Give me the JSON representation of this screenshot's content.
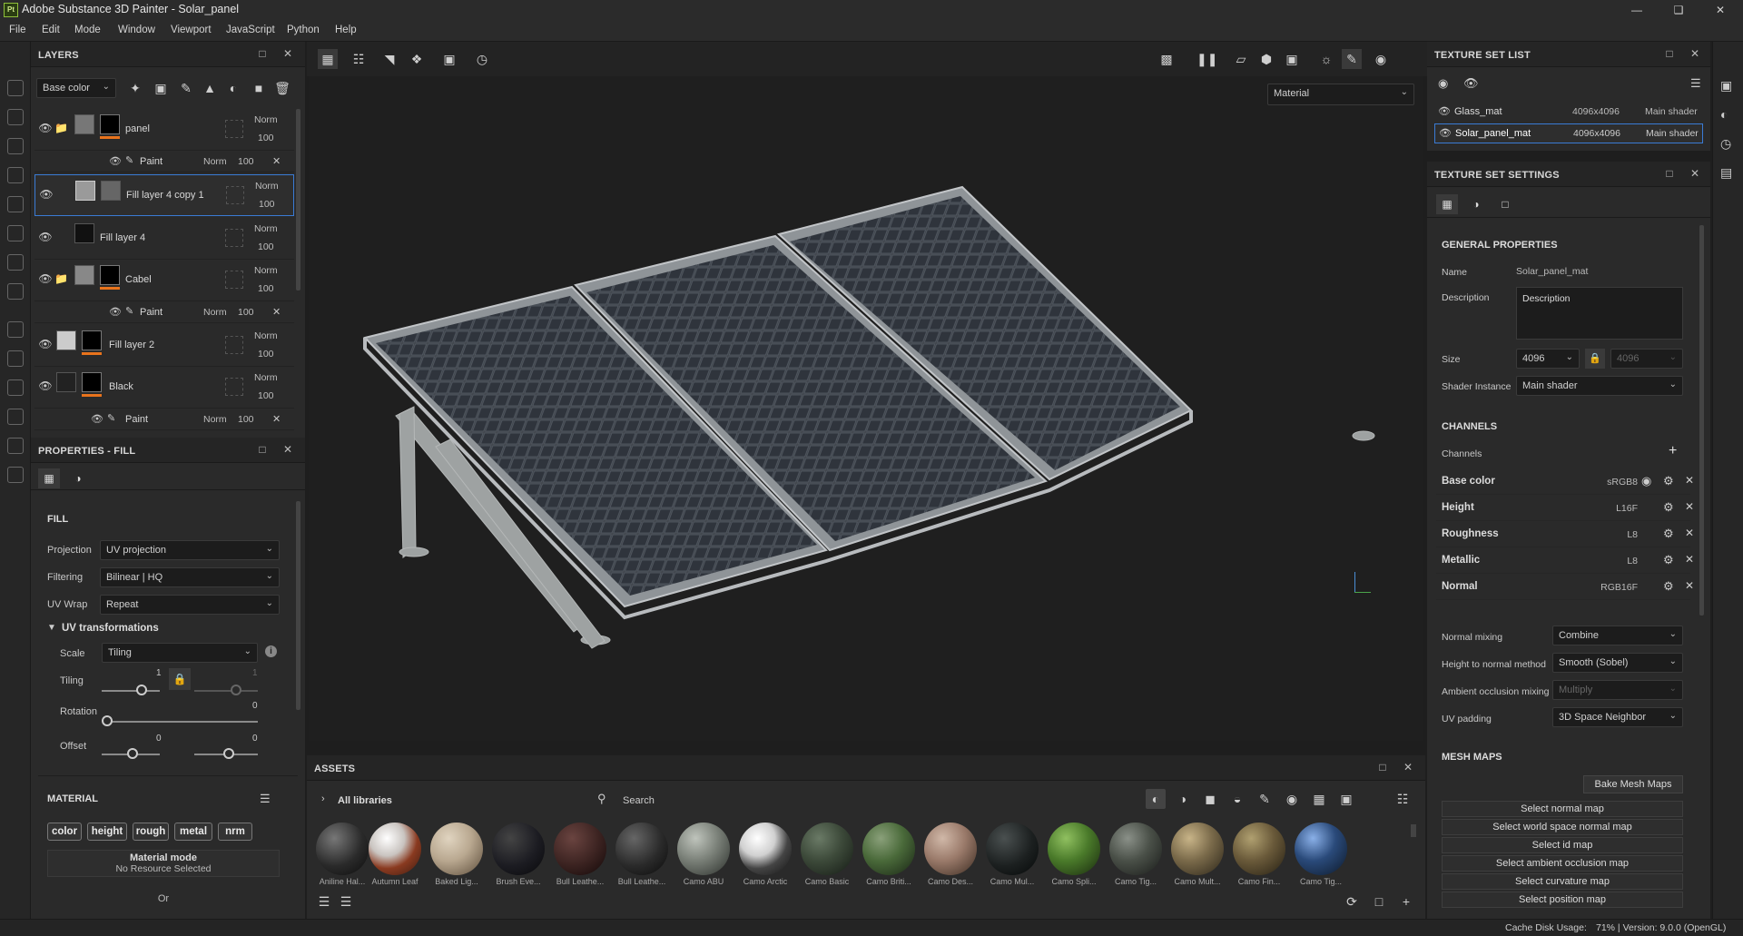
{
  "window": {
    "app_icon": "Pt",
    "title": "Adobe Substance 3D Painter - Solar_panel",
    "controls": [
      "minimize-icon",
      "maximize-icon",
      "close-icon"
    ]
  },
  "menu": [
    "File",
    "Edit",
    "Mode",
    "Window",
    "Viewport",
    "JavaScript",
    "Python",
    "Help"
  ],
  "layers": {
    "title": "LAYERS",
    "channel_select": "Base color",
    "items": [
      {
        "name": "panel",
        "blend": "Norm",
        "opacity": "100",
        "type": "folder",
        "thumb": "#777777"
      },
      {
        "name": "Fill layer 4 copy 1",
        "blend": "Norm",
        "opacity": "100",
        "type": "fill",
        "thumb": "#9a9a9a"
      },
      {
        "name": "Fill layer 4",
        "blend": "Norm",
        "opacity": "100",
        "type": "fill",
        "thumb": "#111111"
      },
      {
        "name": "Cabel",
        "blend": "Norm",
        "opacity": "100",
        "type": "folder",
        "thumb": "#888888"
      },
      {
        "name": "Fill layer 2",
        "blend": "Norm",
        "opacity": "100",
        "type": "fill",
        "thumb": "#cccccc"
      },
      {
        "name": "Black",
        "blend": "Norm",
        "opacity": "100",
        "type": "fill",
        "thumb": "#222222"
      }
    ],
    "paint_sublayer": {
      "name": "Paint",
      "blend": "Norm",
      "opacity": "100"
    }
  },
  "properties": {
    "title": "PROPERTIES - FILL",
    "section": "FILL",
    "projection": {
      "label": "Projection",
      "value": "UV projection"
    },
    "filtering": {
      "label": "Filtering",
      "value": "Bilinear | HQ"
    },
    "uvwrap": {
      "label": "UV Wrap",
      "value": "Repeat"
    },
    "uv_transforms": {
      "title": "UV transformations",
      "scale": {
        "label": "Scale",
        "value": "Tiling"
      },
      "tiling": {
        "label": "Tiling",
        "u": "1",
        "v": "1"
      },
      "rotation": {
        "label": "Rotation",
        "value": "0"
      },
      "offset": {
        "label": "Offset",
        "u": "0",
        "v": "0"
      }
    },
    "material": {
      "title": "MATERIAL",
      "chips": [
        "color",
        "height",
        "rough",
        "metal",
        "nrm"
      ],
      "mode_title": "Material mode",
      "mode_value": "No Resource Selected",
      "or": "Or"
    }
  },
  "viewport": {
    "mode_select": "Material"
  },
  "texture_set_list": {
    "title": "TEXTURE SET LIST",
    "items": [
      {
        "name": "Glass_mat",
        "size": "4096x4096",
        "shader": "Main shader"
      },
      {
        "name": "Solar_panel_mat",
        "size": "4096x4096",
        "shader": "Main shader"
      }
    ]
  },
  "texture_set_settings": {
    "title": "TEXTURE SET SETTINGS",
    "general": "GENERAL PROPERTIES",
    "name_label": "Name",
    "name_value": "Solar_panel_mat",
    "desc_label": "Description",
    "desc_value": "Description",
    "size_label": "Size",
    "size_value": "4096",
    "size_value2": "4096",
    "shader_label": "Shader Instance",
    "shader_value": "Main shader",
    "channels_title": "CHANNELS",
    "channels_label": "Channels",
    "channels": [
      {
        "name": "Base color",
        "format": "sRGB8"
      },
      {
        "name": "Height",
        "format": "L16F"
      },
      {
        "name": "Roughness",
        "format": "L8"
      },
      {
        "name": "Metallic",
        "format": "L8"
      },
      {
        "name": "Normal",
        "format": "RGB16F"
      }
    ],
    "normal_mixing": {
      "label": "Normal mixing",
      "value": "Combine"
    },
    "height_to_normal": {
      "label": "Height to normal method",
      "value": "Smooth (Sobel)"
    },
    "ao_mixing": {
      "label": "Ambient occlusion mixing",
      "value": "Multiply"
    },
    "uv_padding": {
      "label": "UV padding",
      "value": "3D Space Neighbor"
    },
    "mesh_maps_title": "MESH MAPS",
    "bake_button": "Bake Mesh Maps",
    "mesh_map_buttons": [
      "Select normal map",
      "Select world space normal map",
      "Select id map",
      "Select ambient occlusion map",
      "Select curvature map",
      "Select position map"
    ]
  },
  "assets": {
    "title": "ASSETS",
    "library": "All libraries",
    "search_placeholder": "Search",
    "items": [
      {
        "label": "Aniline Hal...",
        "color": "#2a2a2a"
      },
      {
        "label": "Autumn Leaf",
        "color": "#b04a2a"
      },
      {
        "label": "Baked Lig...",
        "color": "#b9a890"
      },
      {
        "label": "Brush Eve...",
        "color": "#1c1c22"
      },
      {
        "label": "Bull Leathe...",
        "color": "#3a2220"
      },
      {
        "label": "Bull Leathe...",
        "color": "#2a2a2a"
      },
      {
        "label": "Camo ABU",
        "color": "#7a8078"
      },
      {
        "label": "Camo Arctic",
        "color": "#d0d0d0"
      },
      {
        "label": "Camo Basic",
        "color": "#3d4a3a"
      },
      {
        "label": "Camo Briti...",
        "color": "#4a6a3a"
      },
      {
        "label": "Camo Des...",
        "color": "#9a7a6a"
      },
      {
        "label": "Camo Mul...",
        "color": "#1c2020"
      },
      {
        "label": "Camo Spli...",
        "color": "#4a7a2a"
      },
      {
        "label": "Camo Tig...",
        "color": "#4a5048"
      },
      {
        "label": "Camo Mult...",
        "color": "#7a6a4a"
      },
      {
        "label": "Camo Fin...",
        "color": "#6a5a3a"
      },
      {
        "label": "Camo Tig...",
        "color": "#2a4a7a"
      }
    ]
  },
  "status": {
    "cache": "Cache Disk Usage:",
    "info": "71% | Version: 9.0.0 (OpenGL)"
  }
}
